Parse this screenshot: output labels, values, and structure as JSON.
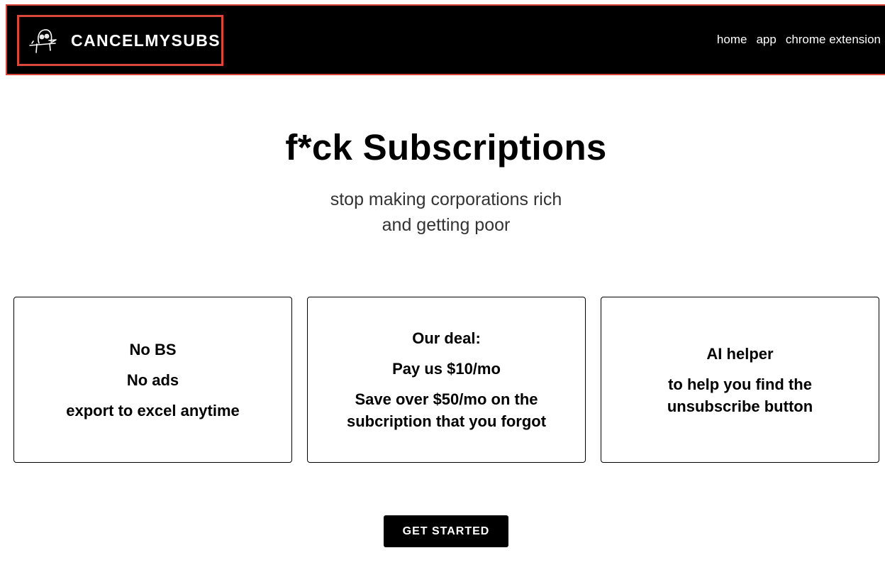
{
  "header": {
    "logo_icon": "doodle-creature-logo",
    "brand_name": "CANCELMYSUBS",
    "nav": [
      {
        "label": "home"
      },
      {
        "label": "app"
      },
      {
        "label": "chrome extension"
      }
    ]
  },
  "hero": {
    "title": "f*ck Subscriptions",
    "subtitle_line1": "stop making corporations rich",
    "subtitle_line2": "and getting poor"
  },
  "cards": [
    {
      "lines": [
        "No BS",
        "No ads",
        "export to excel anytime"
      ]
    },
    {
      "lines": [
        "Our deal:",
        "Pay us $10/mo",
        "Save over $50/mo on the subcription that you forgot"
      ]
    },
    {
      "lines": [
        "AI helper",
        "to help you find the unsubscribe button"
      ]
    }
  ],
  "cta": {
    "label": "GET STARTED"
  },
  "colors": {
    "header_bg": "#000000",
    "highlight_border": "#d9473b",
    "text": "#000000",
    "subtitle": "#333333"
  }
}
